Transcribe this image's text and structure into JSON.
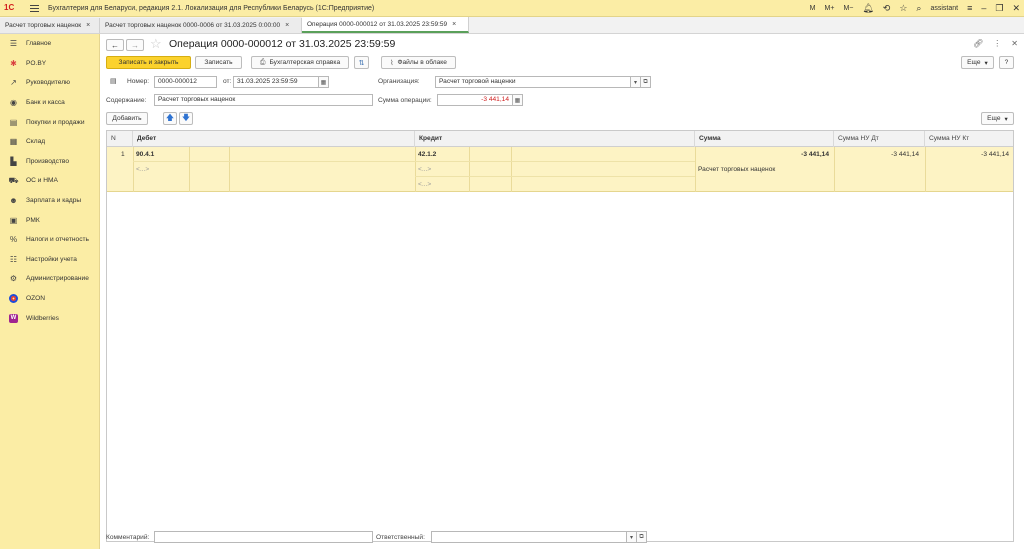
{
  "app": {
    "logo": "1С",
    "title": "Бухгалтерия для Беларуси, редакция 2.1. Локализация для Республики Беларусь   (1С:Предприятие)",
    "user": "assistant",
    "tb_m": "M",
    "tb_mplus": "M+",
    "tb_mminus": "M−"
  },
  "tabs": [
    {
      "label": "Расчет торговых наценок"
    },
    {
      "label": "Расчет торговых наценок 0000-0006 от 31.03.2025 0:00:00"
    },
    {
      "label": "Операция 0000-000012 от 31.03.2025 23:59:59"
    }
  ],
  "sidebar": {
    "items": [
      {
        "label": "Главное",
        "icon": "list-icon"
      },
      {
        "label": "PO.BY",
        "icon": "sun-icon"
      },
      {
        "label": "Руководителю",
        "icon": "chart-icon"
      },
      {
        "label": "Банк и касса",
        "icon": "bank-icon"
      },
      {
        "label": "Покупки и продажи",
        "icon": "cart-icon"
      },
      {
        "label": "Склад",
        "icon": "warehouse-icon"
      },
      {
        "label": "Производство",
        "icon": "factory-icon"
      },
      {
        "label": "ОС и НМА",
        "icon": "truck-icon"
      },
      {
        "label": "Зарплата и кадры",
        "icon": "people-icon"
      },
      {
        "label": "РМК",
        "icon": "cashier-icon"
      },
      {
        "label": "Налоги и отчетность",
        "icon": "percent-icon"
      },
      {
        "label": "Настройки учета",
        "icon": "settings-list-icon"
      },
      {
        "label": "Администрирование",
        "icon": "gear-icon"
      },
      {
        "label": "OZON",
        "icon": "ozon-icon"
      },
      {
        "label": "Wildberries",
        "icon": "wildberries-icon"
      }
    ]
  },
  "document": {
    "title": "Операция 0000-000012 от 31.03.2025 23:59:59",
    "buttons": {
      "save_close": "Записать и закрыть",
      "save": "Записать",
      "report": "Бухгалтерская справка",
      "files": "Файлы в облаке",
      "more": "Еще",
      "help": "?"
    },
    "fields": {
      "number_label": "Номер:",
      "number_value": "0000-000012",
      "date_label": "от:",
      "date_value": "31.03.2025 23:59:59",
      "org_label": "Организация:",
      "org_value": "Расчет торговой наценки",
      "content_label": "Содержание:",
      "content_value": "Расчет торговых наценок",
      "sum_label": "Сумма операции:",
      "sum_value": "-3 441,14"
    },
    "table_toolbar": {
      "add": "Добавить",
      "more": "Еще"
    },
    "table": {
      "columns": [
        "N",
        "Дебет",
        "Кредит",
        "Сумма",
        "Сумма НУ Дт",
        "Сумма НУ Кт"
      ],
      "rows": [
        {
          "n": "1",
          "debit": "90.4.1",
          "debit_sub": "<...>",
          "credit": "42.1.2",
          "credit_sub1": "<...>",
          "credit_sub2": "<...>",
          "sum": "-3 441,14",
          "sum_desc": "Расчет торговых наценок",
          "sum_nu_dt": "-3 441,14",
          "sum_nu_kt": "-3 441,14"
        }
      ]
    },
    "footer": {
      "comment_label": "Комментарий:",
      "comment_value": "",
      "responsible_label": "Ответственный:",
      "responsible_value": ""
    }
  }
}
